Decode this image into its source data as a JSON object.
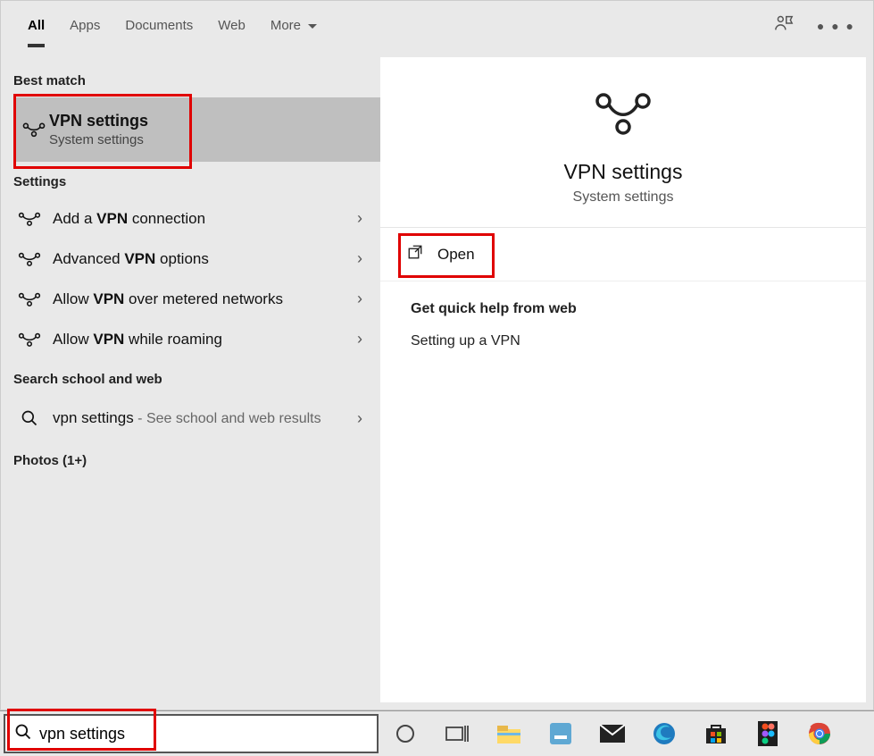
{
  "tabs": {
    "all": "All",
    "apps": "Apps",
    "documents": "Documents",
    "web": "Web",
    "more": "More"
  },
  "sections": {
    "bestMatch": "Best match",
    "settings": "Settings",
    "searchWeb": "Search school and web",
    "photos": "Photos (1+)"
  },
  "bestMatch": {
    "title": "VPN settings",
    "subtitle": "System settings"
  },
  "settingsItems": [
    {
      "pre": "Add a ",
      "bold": "VPN",
      "post": " connection"
    },
    {
      "pre": "Advanced ",
      "bold": "VPN",
      "post": " options"
    },
    {
      "pre": "Allow ",
      "bold": "VPN",
      "post": " over metered networks"
    },
    {
      "pre": "Allow ",
      "bold": "VPN",
      "post": " while roaming"
    }
  ],
  "webResult": {
    "query": "vpn settings",
    "suffix": " - See school and web results"
  },
  "rightPanel": {
    "title": "VPN settings",
    "subtitle": "System settings",
    "open": "Open",
    "helpTitle": "Get quick help from web",
    "helpItem": "Setting up a VPN"
  },
  "searchBox": {
    "value": "vpn settings"
  }
}
